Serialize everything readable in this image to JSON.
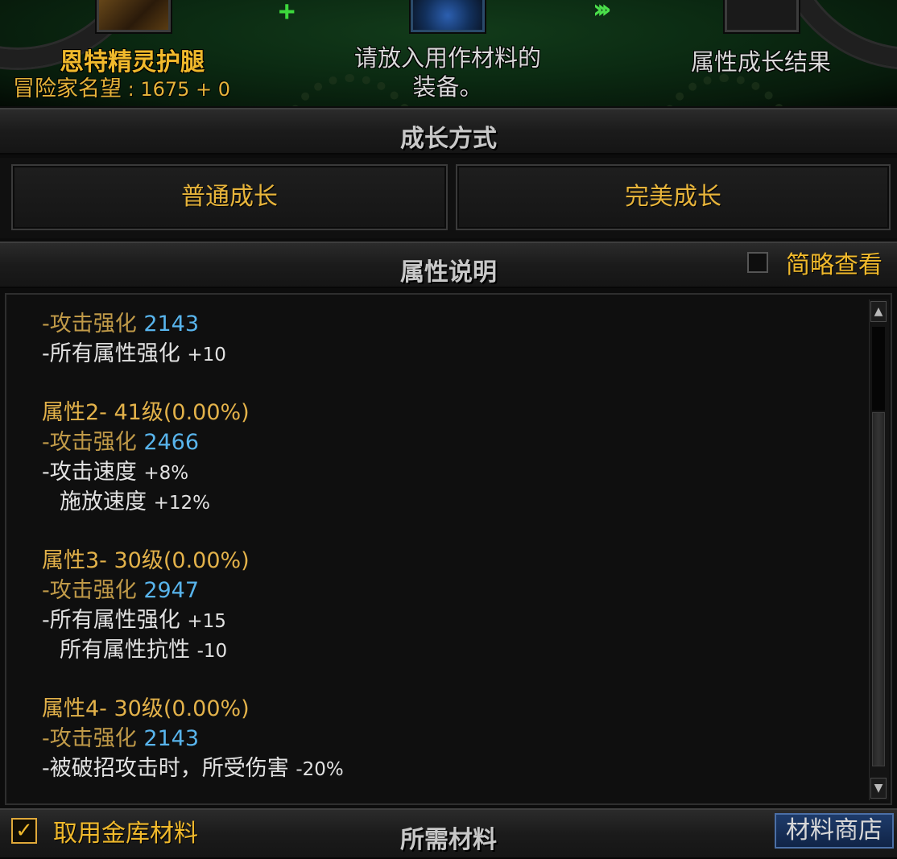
{
  "top": {
    "item_name": "恩特精灵护腿",
    "fame_label": "冒险家名望",
    "fame_value": "1675 + 0",
    "material_hint_line1": "请放入用作材料的",
    "material_hint_line2": "装备。",
    "result_label": "属性成长结果"
  },
  "growth": {
    "title": "成长方式",
    "normal_label": "普通成长",
    "perfect_label": "完美成长"
  },
  "attributes": {
    "title": "属性说明",
    "brief_label": "简略查看",
    "lines": [
      {
        "a": "-攻击强化 ",
        "a_cls": "c-dim",
        "b": "2143",
        "b_cls": "c-blue"
      },
      {
        "a": "-所有属性强化 ",
        "a_cls": "c-white",
        "b": "+10",
        "b_cls": "c-num"
      },
      {
        "gap": true
      },
      {
        "a": "属性2- 41级(0.00%)",
        "a_cls": "c-gold"
      },
      {
        "a": "-攻击强化 ",
        "a_cls": "c-dim",
        "b": "2466",
        "b_cls": "c-blue"
      },
      {
        "a": "-攻击速度 ",
        "a_cls": "c-white",
        "b": "+8%",
        "b_cls": "c-num"
      },
      {
        "a": "施放速度 ",
        "a_cls": "c-white",
        "b": "+12%",
        "b_cls": "c-num",
        "indent": true
      },
      {
        "gap": true
      },
      {
        "a": "属性3- 30级(0.00%)",
        "a_cls": "c-gold"
      },
      {
        "a": "-攻击强化 ",
        "a_cls": "c-dim",
        "b": "2947",
        "b_cls": "c-blue"
      },
      {
        "a": "-所有属性强化 ",
        "a_cls": "c-white",
        "b": "+15",
        "b_cls": "c-num"
      },
      {
        "a": "所有属性抗性 ",
        "a_cls": "c-white",
        "b": "-10",
        "b_cls": "c-num",
        "indent": true
      },
      {
        "gap": true
      },
      {
        "a": "属性4- 30级(0.00%)",
        "a_cls": "c-gold"
      },
      {
        "a": "-攻击强化 ",
        "a_cls": "c-dim",
        "b": "2143",
        "b_cls": "c-blue"
      },
      {
        "a": "-被破招攻击时，所受伤害 ",
        "a_cls": "c-white",
        "b": "-20%",
        "b_cls": "c-num"
      }
    ]
  },
  "materials": {
    "vault_checkbox_label": "取用金库材料",
    "vault_checked": true,
    "title": "所需材料",
    "shop_label": "材料商店"
  },
  "colors": {
    "gold": "#f0b92c",
    "blue_value": "#58b4ec",
    "green_accent": "#3cd83c"
  }
}
